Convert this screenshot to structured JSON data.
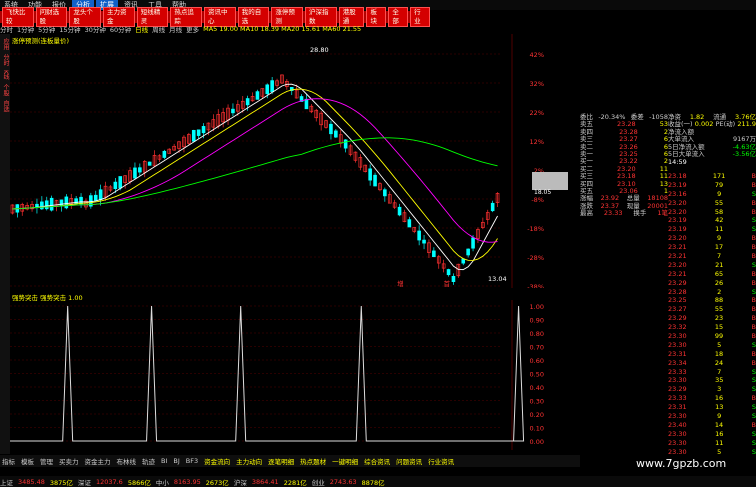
{
  "menu": {
    "items": [
      "系统",
      "功能",
      "报价",
      "分析",
      "扩展",
      "资讯",
      "工具",
      "帮助"
    ],
    "highlight": [
      "分析",
      "扩展"
    ]
  },
  "toolbar": {
    "items": [
      "飞快比较",
      "问财选股",
      "龙头个股",
      "主力资金",
      "短线精灵",
      "热点追踪",
      "资讯中心",
      "我的自选",
      "涨停预测",
      "沪深指数",
      "港股通",
      "板块",
      "全部",
      "行业"
    ]
  },
  "period": {
    "items": [
      "分时",
      "1分钟",
      "5分钟",
      "15分钟",
      "30分钟",
      "60分钟",
      "日线",
      "周线",
      "月线",
      "更多"
    ],
    "selected": "日线",
    "ma": "MA5 19.00  MA10 18.39  MA20 15.61  MA60 21.55"
  },
  "main_chart": {
    "legend": "涨停预测(连板量价)",
    "high_label": "28.80",
    "low_label": "13.04",
    "crosshair_label": "18.05",
    "right_axis": [
      "42%",
      "32%",
      "22%",
      "12%",
      "2%",
      "-8%",
      "-18%",
      "-28%",
      "-38%"
    ],
    "events": [
      {
        "text": "增",
        "pos": 0.79
      },
      {
        "text": "首",
        "pos": 0.885
      }
    ]
  },
  "sub_chart": {
    "title": "强势突击  强势突击 1.00",
    "right_axis": [
      "1.00",
      "0.90",
      "0.80",
      "0.70",
      "0.60",
      "0.50",
      "0.40",
      "0.30",
      "0.20",
      "0.10",
      "0.00"
    ],
    "spikes": [
      0.11,
      0.27,
      0.44,
      0.67,
      0.97
    ]
  },
  "orderbook": {
    "header": [
      "委比",
      "-20.34%",
      "委差",
      "-1058"
    ],
    "sell": [
      [
        "卖五",
        "23.28",
        "53"
      ],
      [
        "卖四",
        "23.28",
        "2"
      ],
      [
        "卖三",
        "23.27",
        "6"
      ],
      [
        "卖二",
        "23.26",
        "6"
      ],
      [
        "卖一",
        "23.25",
        "6"
      ]
    ],
    "buy": [
      [
        "买一",
        "23.22",
        "2"
      ],
      [
        "买二",
        "23.20",
        "11"
      ],
      [
        "买三",
        "23.18",
        "11"
      ],
      [
        "买四",
        "23.10",
        "13"
      ],
      [
        "买五",
        "23.06",
        "1"
      ]
    ],
    "stats": [
      [
        "涨幅",
        "23.92",
        "总量",
        "18108"
      ],
      [
        "涨跌",
        "23.37",
        "现量",
        "20001"
      ],
      [
        "最高",
        "23.33",
        "换手",
        "1笔"
      ]
    ]
  },
  "quote": {
    "rows": [
      [
        "净资",
        "1.82",
        "流通",
        "3.76亿"
      ],
      [
        "收益(一)",
        "0.002",
        "PE(动)",
        "211.9"
      ],
      [
        "净流入额",
        "",
        "",
        ""
      ],
      [
        "大单流入",
        "",
        "9167万",
        ""
      ],
      [
        "5日净流入额",
        "",
        "-4.63亿",
        ""
      ],
      [
        "5日大单流入",
        "",
        "-3.56亿",
        ""
      ]
    ],
    "time": "14:59"
  },
  "ticks": [
    [
      "23.18",
      "171",
      "B"
    ],
    [
      "23.19",
      "79",
      "B"
    ],
    [
      "23.16",
      "9",
      "S"
    ],
    [
      "23.20",
      "55",
      "B"
    ],
    [
      "23.20",
      "58",
      "B"
    ],
    [
      "23.19",
      "42",
      "S"
    ],
    [
      "23.19",
      "11",
      "S"
    ],
    [
      "23.20",
      "9",
      "B"
    ],
    [
      "23.21",
      "17",
      "B"
    ],
    [
      "23.21",
      "7",
      "B"
    ],
    [
      "23.20",
      "21",
      "S"
    ],
    [
      "23.21",
      "65",
      "B"
    ],
    [
      "23.29",
      "26",
      "B"
    ],
    [
      "23.28",
      "2",
      "S"
    ],
    [
      "23.25",
      "88",
      "B"
    ],
    [
      "23.27",
      "55",
      "B"
    ],
    [
      "23.29",
      "23",
      "B"
    ],
    [
      "23.32",
      "15",
      "B"
    ],
    [
      "23.30",
      "99",
      "B"
    ],
    [
      "23.30",
      "5",
      "S"
    ],
    [
      "23.31",
      "18",
      "B"
    ],
    [
      "23.34",
      "24",
      "B"
    ],
    [
      "23.33",
      "7",
      "S"
    ],
    [
      "23.30",
      "35",
      "S"
    ],
    [
      "23.29",
      "3",
      "S"
    ],
    [
      "23.33",
      "16",
      "B"
    ],
    [
      "23.31",
      "13",
      "S"
    ],
    [
      "23.30",
      "9",
      "S"
    ],
    [
      "23.40",
      "14",
      "B"
    ],
    [
      "23.30",
      "16",
      "S"
    ],
    [
      "23.30",
      "11",
      "S"
    ],
    [
      "23.30",
      "5",
      "S"
    ]
  ],
  "bottom": {
    "tabs": [
      "指标",
      "模板",
      "管理",
      "买卖力",
      "资金主力",
      "布林线",
      "轨迹",
      "BI",
      "BJ",
      "BF3"
    ],
    "sub": [
      "资金流向",
      "主力动向",
      "逐笔明细",
      "热点题材",
      "一键明细",
      "综合资讯",
      "问题资讯",
      "行业资讯"
    ]
  },
  "index": {
    "items": [
      [
        "上证",
        "3485.48",
        "3875亿"
      ],
      [
        "深证",
        "12037.6",
        "5866亿"
      ],
      [
        "中小",
        "8163.95",
        "2673亿"
      ],
      [
        "沪深",
        "3864.41",
        "2281亿"
      ],
      [
        "创业",
        "2743.63",
        "8878亿"
      ]
    ]
  },
  "watermark": "www.7gpzb.com",
  "colors": {
    "up": "#ff3030",
    "down": "#00ffff",
    "ma5": "#ffffff",
    "ma10": "#ffff00",
    "ma20": "#ff00ff",
    "ma60": "#00ff00"
  }
}
